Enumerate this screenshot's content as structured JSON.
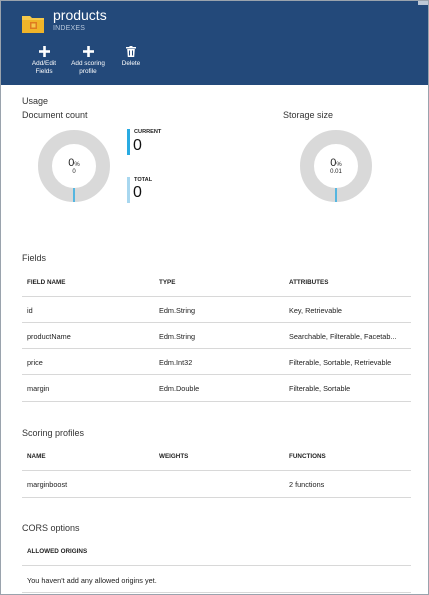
{
  "header": {
    "title": "products",
    "subtitle": "INDEXES",
    "commands": [
      {
        "label_line1": "Add/Edit",
        "label_line2": "Fields",
        "icon": "plus-icon"
      },
      {
        "label_line1": "Add scoring",
        "label_line2": "profile",
        "icon": "plus-icon"
      },
      {
        "label_line1": "Delete",
        "label_line2": "",
        "icon": "trash-icon"
      }
    ]
  },
  "usage": {
    "title": "Usage",
    "document_count": {
      "label": "Document count",
      "percent": "0",
      "percent_unit": "%",
      "sub_value": "0",
      "current_label": "CURRENT",
      "current_value": "0",
      "total_label": "TOTAL",
      "total_value": "0"
    },
    "storage_size": {
      "label": "Storage size",
      "percent": "0",
      "percent_unit": "%",
      "sub_value": "0.01"
    }
  },
  "fields": {
    "title": "Fields",
    "columns": [
      "FIELD NAME",
      "TYPE",
      "ATTRIBUTES"
    ],
    "rows": [
      {
        "name": "id",
        "type": "Edm.String",
        "attributes": "Key, Retrievable"
      },
      {
        "name": "productName",
        "type": "Edm.String",
        "attributes": "Searchable, Filterable, Facetab..."
      },
      {
        "name": "price",
        "type": "Edm.Int32",
        "attributes": "Filterable, Sortable, Retrievable"
      },
      {
        "name": "margin",
        "type": "Edm.Double",
        "attributes": "Filterable, Sortable"
      }
    ]
  },
  "scoring": {
    "title": "Scoring profiles",
    "columns": [
      "NAME",
      "WEIGHTS",
      "FUNCTIONS"
    ],
    "rows": [
      {
        "name": "marginboost",
        "weights": "",
        "functions": "2 functions"
      }
    ]
  },
  "cors": {
    "title": "CORS options",
    "column": "ALLOWED ORIGINS",
    "empty_message": "You haven't add any allowed origins yet."
  },
  "colors": {
    "header_bg": "#23497a",
    "accent": "#29abe2",
    "donut_track": "#d9d9d9"
  }
}
